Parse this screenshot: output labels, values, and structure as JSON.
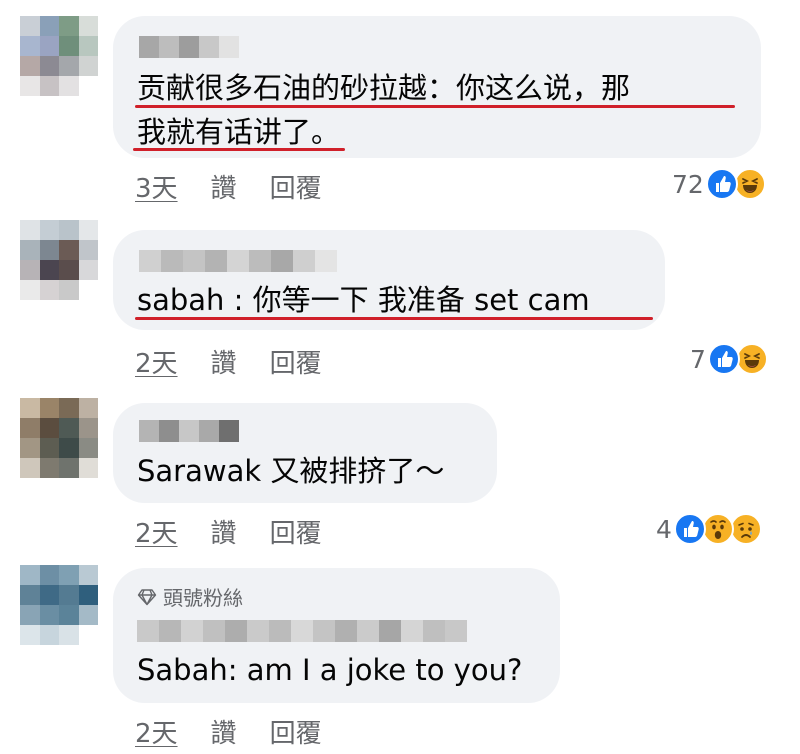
{
  "comments": [
    {
      "text_lines": [
        "贡献很多石油的砂拉越：你这么说，那",
        "我就有话讲了。"
      ],
      "time": "3天",
      "like": "讚",
      "reply": "回覆",
      "reaction_count": "72",
      "reactions": [
        "like-icon",
        "haha-icon"
      ]
    },
    {
      "text_lines": [
        "sabah : 你等一下 我准备 set cam"
      ],
      "time": "2天",
      "like": "讚",
      "reply": "回覆",
      "reaction_count": "7",
      "reactions": [
        "like-icon",
        "haha-icon"
      ]
    },
    {
      "text_lines": [
        "Sarawak 又被排挤了～"
      ],
      "time": "2天",
      "like": "讚",
      "reply": "回覆",
      "reaction_count": "4",
      "reactions": [
        "like-icon",
        "wow-icon",
        "sad-icon"
      ]
    },
    {
      "badge": "頭號粉絲",
      "text_lines": [
        "Sabah: am I a joke to you?"
      ],
      "time": "2天",
      "like": "讚",
      "reply": "回覆"
    }
  ],
  "colors": {
    "bubble": "#f0f2f5",
    "underline": "#d0202a",
    "meta_text": "#65676b",
    "like_blue": "#1877f2",
    "emoji_yellow": "#f7b125"
  }
}
